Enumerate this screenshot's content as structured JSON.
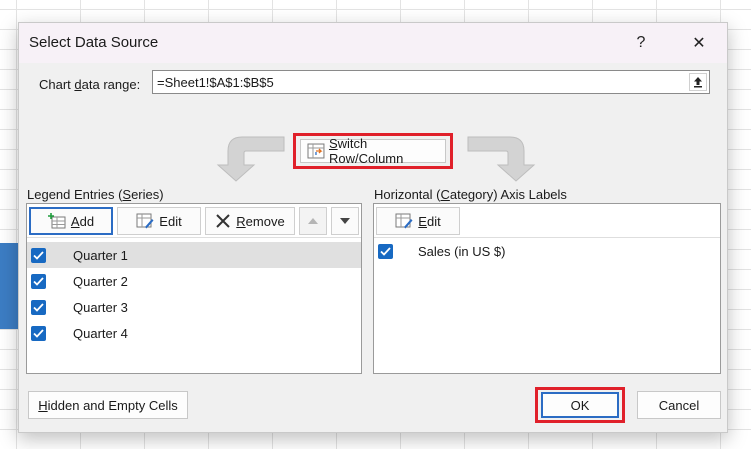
{
  "dialog": {
    "title": "Select Data Source",
    "help_label": "?",
    "close_label": "✕"
  },
  "chart_range": {
    "label_prefix": "Chart ",
    "label_accel": "d",
    "label_suffix": "ata range:",
    "value": "=Sheet1!$A$1:$B$5"
  },
  "switch": {
    "accel": "S",
    "label_rest": "witch Row/Column"
  },
  "legend": {
    "label_prefix": "Legend Entries (",
    "label_accel": "S",
    "label_suffix": "eries)",
    "add_accel": "A",
    "add_rest": "dd",
    "edit_label": "Edit",
    "remove_accel": "R",
    "remove_rest": "emove",
    "items": [
      {
        "label": "Quarter 1",
        "checked": true,
        "selected": true
      },
      {
        "label": "Quarter 2",
        "checked": true,
        "selected": false
      },
      {
        "label": "Quarter 3",
        "checked": true,
        "selected": false
      },
      {
        "label": "Quarter 4",
        "checked": true,
        "selected": false
      }
    ]
  },
  "axis": {
    "label_prefix": "Horizontal (",
    "label_accel": "C",
    "label_suffix": "ategory) Axis Labels",
    "edit_accel": "E",
    "edit_rest": "dit",
    "items": [
      {
        "label": "Sales (in US $)",
        "checked": true
      }
    ]
  },
  "footer": {
    "hidden_accel": "H",
    "hidden_rest": "idden and Empty Cells",
    "ok_label": "OK",
    "cancel_label": "Cancel"
  },
  "colors": {
    "accent": "#1769c2",
    "highlight": "#e0202a",
    "sheet_selection": "#3c7dc4"
  }
}
